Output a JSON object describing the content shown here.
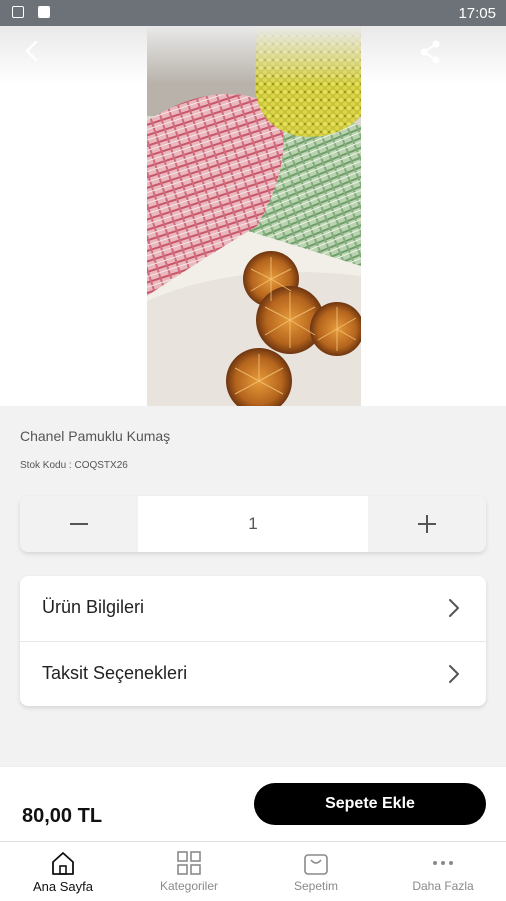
{
  "status_bar": {
    "time": "17:05"
  },
  "product": {
    "name": "Chanel Pamuklu Kumaş",
    "sku": "Stok Kodu : COQSTX26",
    "quantity": "1",
    "price": "80,00 TL",
    "add_to_cart_label": "Sepete Ekle"
  },
  "info_rows": [
    {
      "label": "Ürün Bilgileri"
    },
    {
      "label": "Taksit Seçenekleri"
    }
  ],
  "tabs": [
    {
      "label": "Ana Sayfa",
      "icon": "home-icon",
      "active": true
    },
    {
      "label": "Kategoriler",
      "icon": "grid-icon",
      "active": false
    },
    {
      "label": "Sepetim",
      "icon": "cart-icon",
      "active": false
    },
    {
      "label": "Daha Fazla",
      "icon": "more-icon",
      "active": false
    }
  ],
  "colors": {
    "accent": "#000000",
    "background": "#f2f2f2",
    "statusbar": "#6d7278"
  }
}
